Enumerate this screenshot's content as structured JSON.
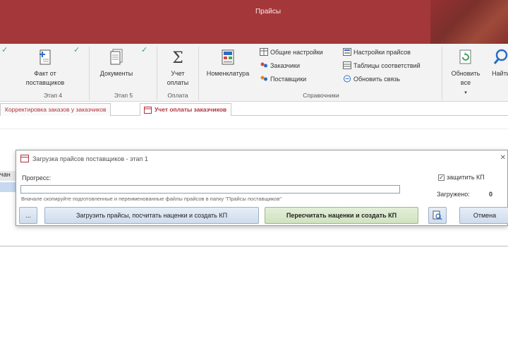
{
  "app": {
    "title": "Прайсы"
  },
  "ribbon": {
    "buttons": {
      "fakt": "Факт от поставщиков",
      "documents": "Документы",
      "uchet": "Учет оплаты",
      "nomenclature": "Номенклатура",
      "refresh": "Обновить все",
      "find": "Найти"
    },
    "refresh_suffix": "▾",
    "groups": {
      "etap4": "Этап 4",
      "etap5": "Этап 5",
      "oplata": "Оплата",
      "spravochniki": "Справочники"
    },
    "small_items": {
      "general_settings": "Общие настройки",
      "customers": "Заказчики",
      "suppliers": "Поставщики",
      "price_settings": "Настройки прайсов",
      "mapping_tables": "Таблицы соответствий",
      "update_link": "Обновить связь"
    }
  },
  "tabs": [
    {
      "label": "Корректировка заказов у заказчиков"
    },
    {
      "label": "Учет оплаты заказчиков"
    }
  ],
  "background_form": {
    "cell_label": "чан"
  },
  "dialog": {
    "title": "Загрузка прайсов поставщиков - этап 1",
    "progress_label": "Прогресс:",
    "progress_value": 0,
    "hint": "Вначале скопируйте подготовленные и переименованные файлы прайсов в папку \"Прайсы поставщиков\"",
    "protect_kp_label": "защитить КП",
    "protect_kp_checked": true,
    "loaded_label": "Загружено:",
    "loaded_value": "0",
    "buttons": {
      "browse": "...",
      "load": "Загрузить прайсы, посчитать наценки и создать КП",
      "recalc": "Пересчитать наценки и создать КП",
      "cancel": "Отмена"
    }
  },
  "colors": {
    "titlebar": "#a4373a",
    "accent_red": "#b0313b",
    "check_green": "#3aa55a"
  }
}
